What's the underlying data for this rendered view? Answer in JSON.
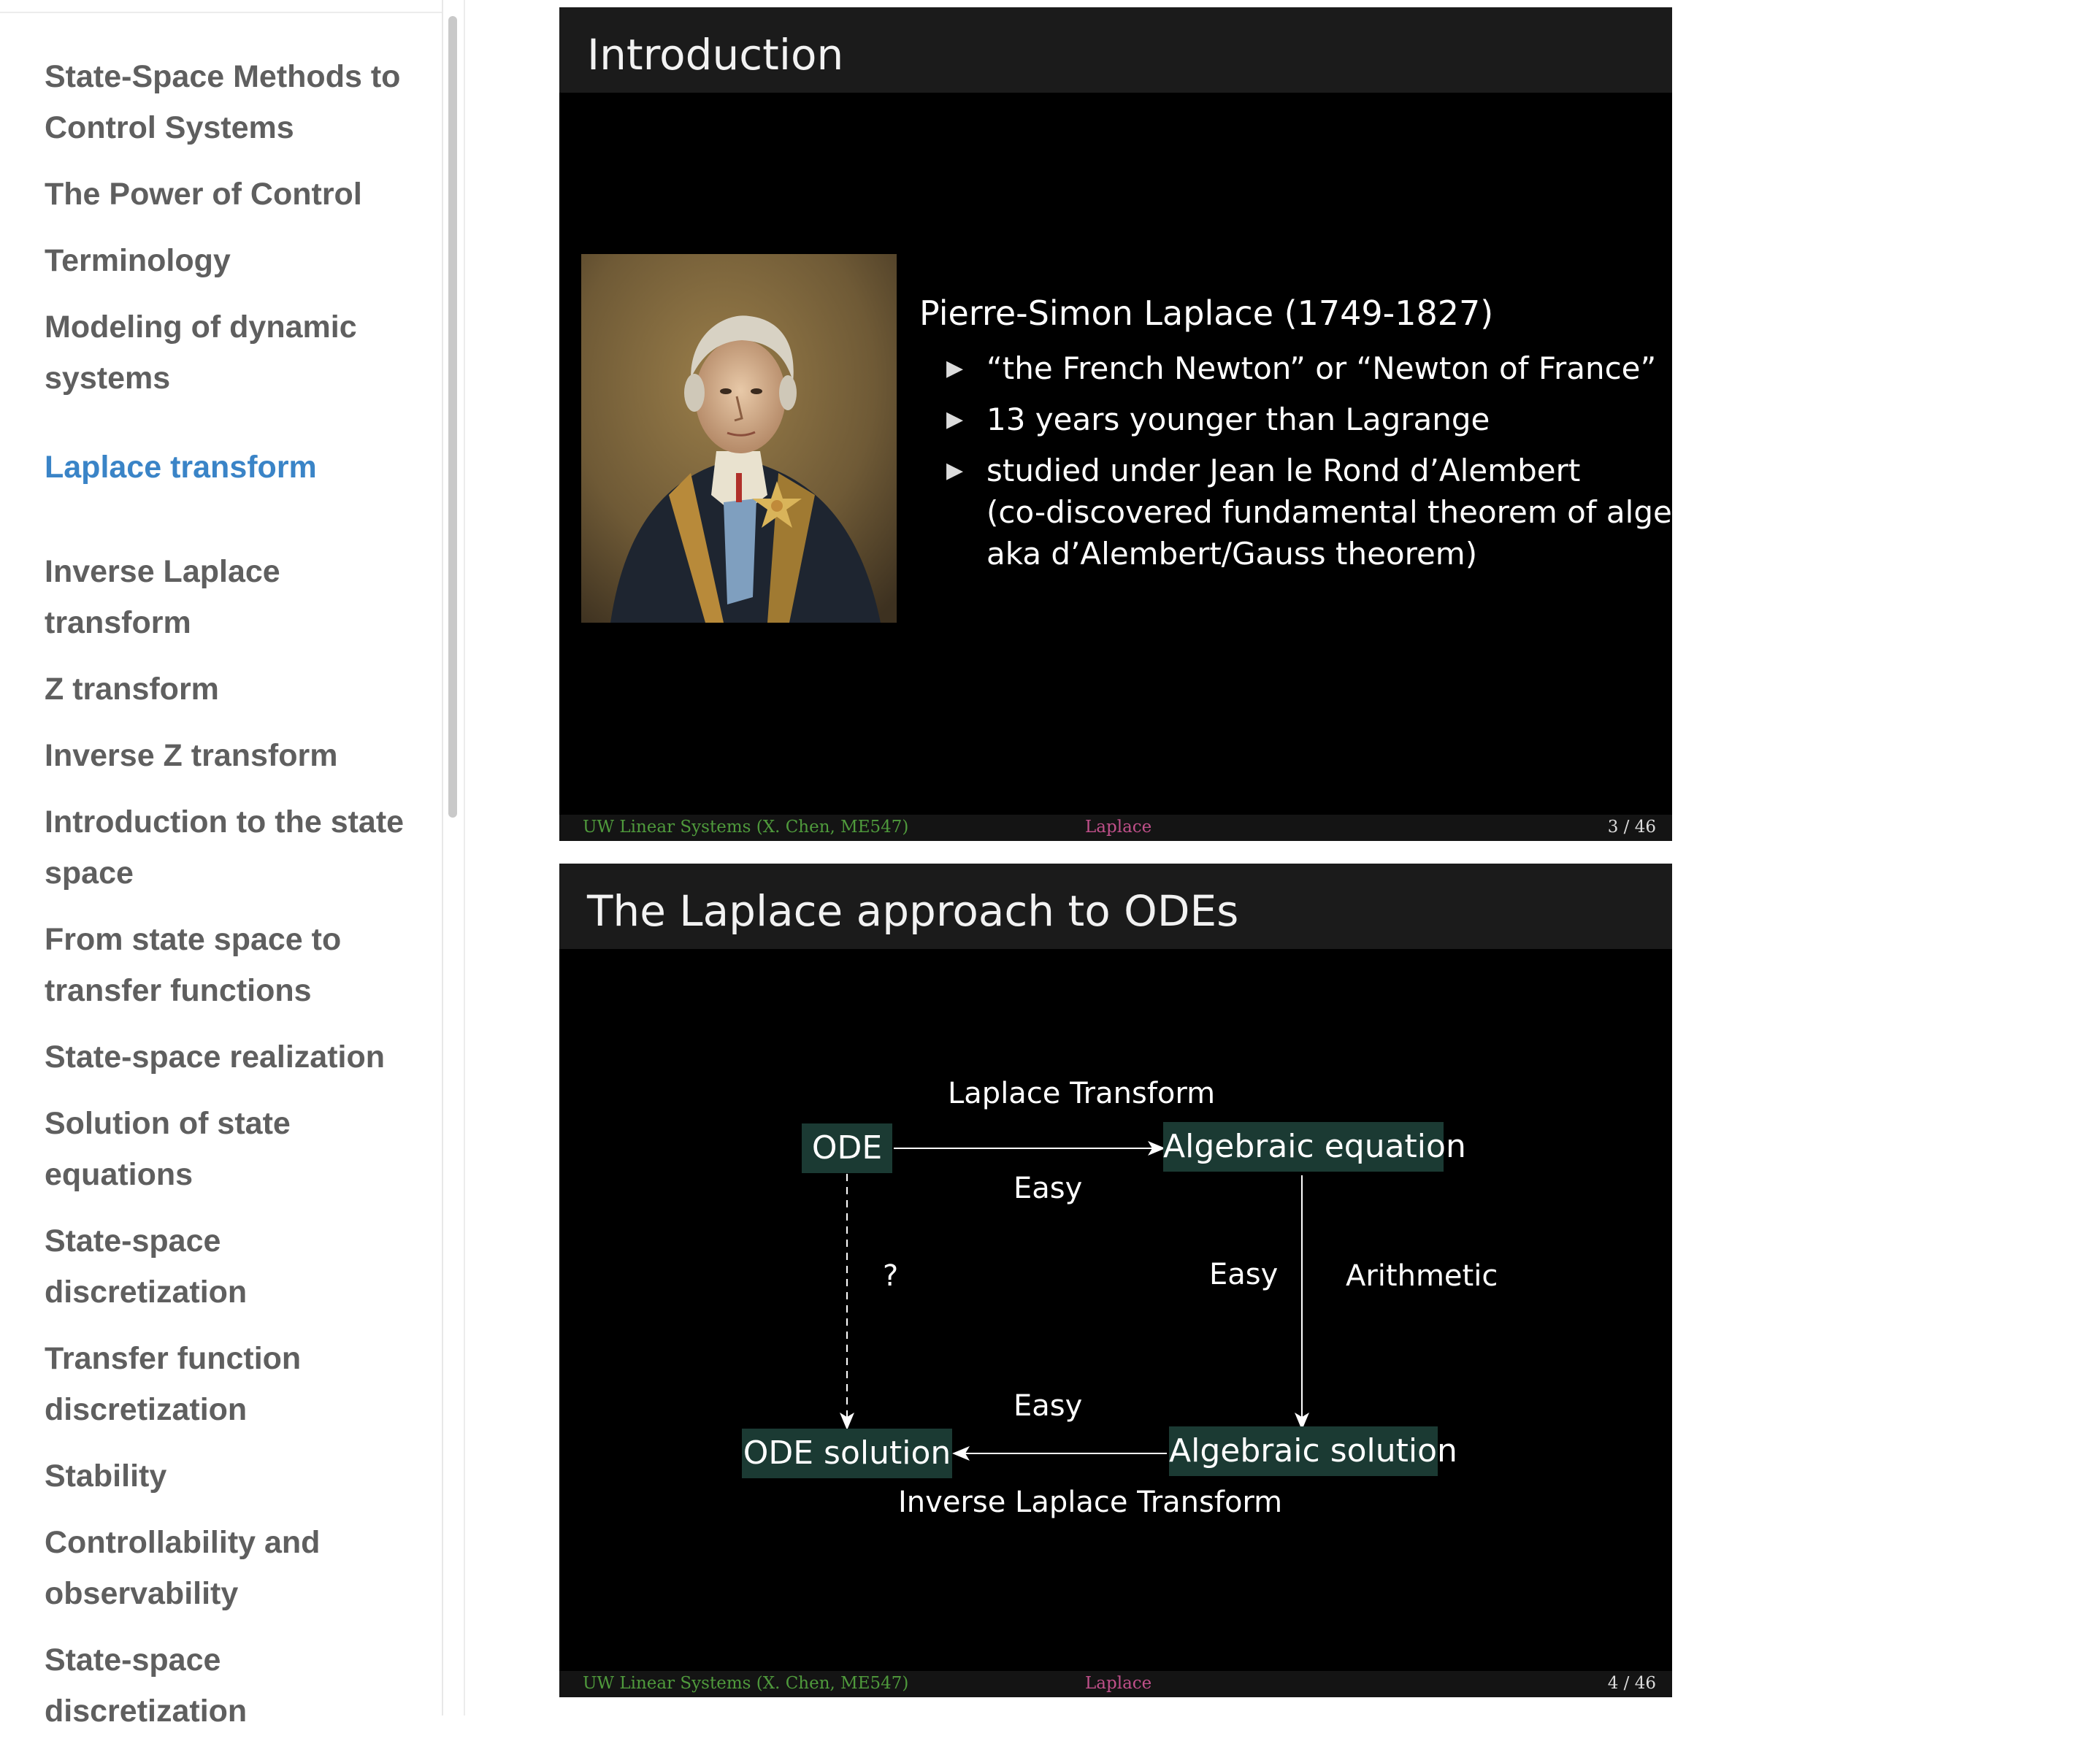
{
  "sidebar": {
    "items": [
      {
        "label": "State-Space Methods to Control Systems"
      },
      {
        "label": "The Power of Control"
      },
      {
        "label": "Terminology"
      },
      {
        "label": "Modeling of dynamic systems"
      },
      {
        "label": "Laplace transform",
        "active": true
      },
      {
        "label": "Inverse Laplace transform"
      },
      {
        "label": "Z transform"
      },
      {
        "label": "Inverse Z transform"
      },
      {
        "label": "Introduction to the state space"
      },
      {
        "label": "From state space to transfer functions"
      },
      {
        "label": "State-space realization"
      },
      {
        "label": "Solution of state equations"
      },
      {
        "label": "State-space discretization"
      },
      {
        "label": "Transfer function discretization"
      },
      {
        "label": "Stability"
      },
      {
        "label": "Controllability and observability"
      },
      {
        "label": "State-space discretization"
      }
    ]
  },
  "colors": {
    "sidebar_text": "#5f5f5f",
    "sidebar_active": "#3a84c7",
    "slide_bg": "#000000",
    "header_bg": "#1b1b1b",
    "node_bg": "#1b3a33",
    "footer_left": "#4f9a3c",
    "footer_mid": "#c0508a"
  },
  "slides": [
    {
      "title": "Introduction",
      "portrait_icon": "portrait-image",
      "person": "Pierre-Simon Laplace (1749-1827)",
      "bullets": [
        "“the French Newton” or “Newton of France”",
        "13 years younger than Lagrange",
        "studied under Jean le Rond d’Alembert",
        "(co-discovered fundamental theorem of algebra,",
        "aka d’Alembert/Gauss theorem)"
      ],
      "footer": {
        "left": "UW Linear Systems  (X. Chen, ME547)",
        "mid": "Laplace",
        "page": "3 / 46"
      }
    },
    {
      "title": "The Laplace approach to ODEs",
      "diagram": {
        "ode": "ODE",
        "algebraic_equation": "Algebraic equation",
        "ode_solution": "ODE solution",
        "algebraic_solution": "Algebraic solution",
        "laplace_transform": "Laplace Transform",
        "inverse_laplace_transform": "Inverse Laplace Transform",
        "easy": "Easy",
        "question": "?",
        "arithmetic": "Arithmetic"
      },
      "footer": {
        "left": "UW Linear Systems  (X. Chen, ME547)",
        "mid": "Laplace",
        "page": "4 / 46"
      }
    }
  ]
}
